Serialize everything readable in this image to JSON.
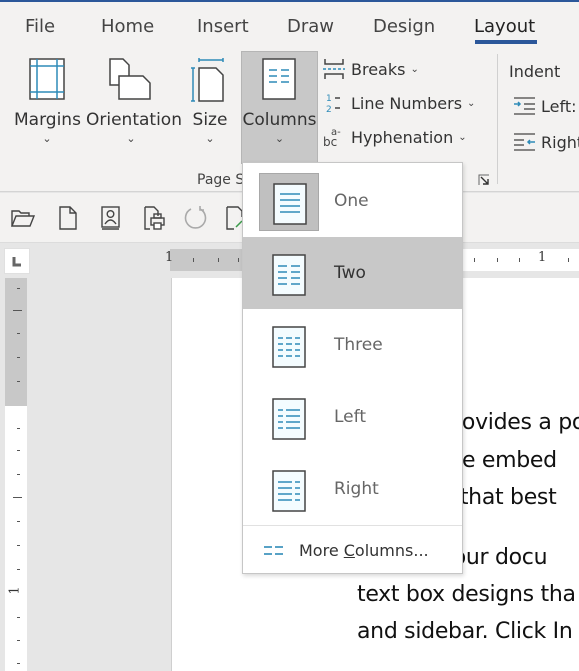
{
  "ribbon": {
    "tabs": [
      {
        "label": "File",
        "active": false
      },
      {
        "label": "Home",
        "active": false
      },
      {
        "label": "Insert",
        "active": false
      },
      {
        "label": "Draw",
        "active": false
      },
      {
        "label": "Design",
        "active": false
      },
      {
        "label": "Layout",
        "active": true
      }
    ],
    "page_setup": {
      "margins_label": "Margins",
      "orientation_label": "Orientation",
      "size_label": "Size",
      "columns_label": "Columns",
      "breaks_label": "Breaks",
      "line_numbers_label": "Line Numbers",
      "hyphenation_label": "Hyphenation",
      "group_label": "Page S"
    },
    "indent": {
      "title": "Indent",
      "left_label": "Left:",
      "right_label": "Right"
    }
  },
  "quick_access": {
    "icons": [
      "open-folder-icon",
      "new-document-icon",
      "contacts-icon",
      "print-preview-icon",
      "redo-icon",
      "save-as-icon"
    ]
  },
  "rulers": {
    "horizontal_labels": [
      "1",
      "1"
    ],
    "vertical_labels": [
      "1"
    ]
  },
  "columns_dropdown": {
    "items": [
      {
        "label": "One",
        "icon": "one-column-icon",
        "selected": true,
        "hovered": false
      },
      {
        "label": "Two",
        "icon": "two-columns-icon",
        "selected": false,
        "hovered": true
      },
      {
        "label": "Three",
        "icon": "three-columns-icon",
        "selected": false,
        "hovered": false
      },
      {
        "label": "Left",
        "icon": "left-column-icon",
        "selected": false,
        "hovered": false
      },
      {
        "label": "Right",
        "icon": "right-column-icon",
        "selected": false,
        "hovered": false
      }
    ],
    "more_prefix": "More ",
    "more_underlined": "C",
    "more_suffix": "olumns..."
  },
  "document": {
    "lines": [
      "provides a po",
      "the embed",
      "o that best",
      "your docu",
      "text box designs tha",
      "and sidebar. Click In"
    ]
  },
  "colors": {
    "accent": "#2b579a",
    "icon_blue": "#2e8bb8",
    "hover_gray": "#c8c8c8"
  }
}
